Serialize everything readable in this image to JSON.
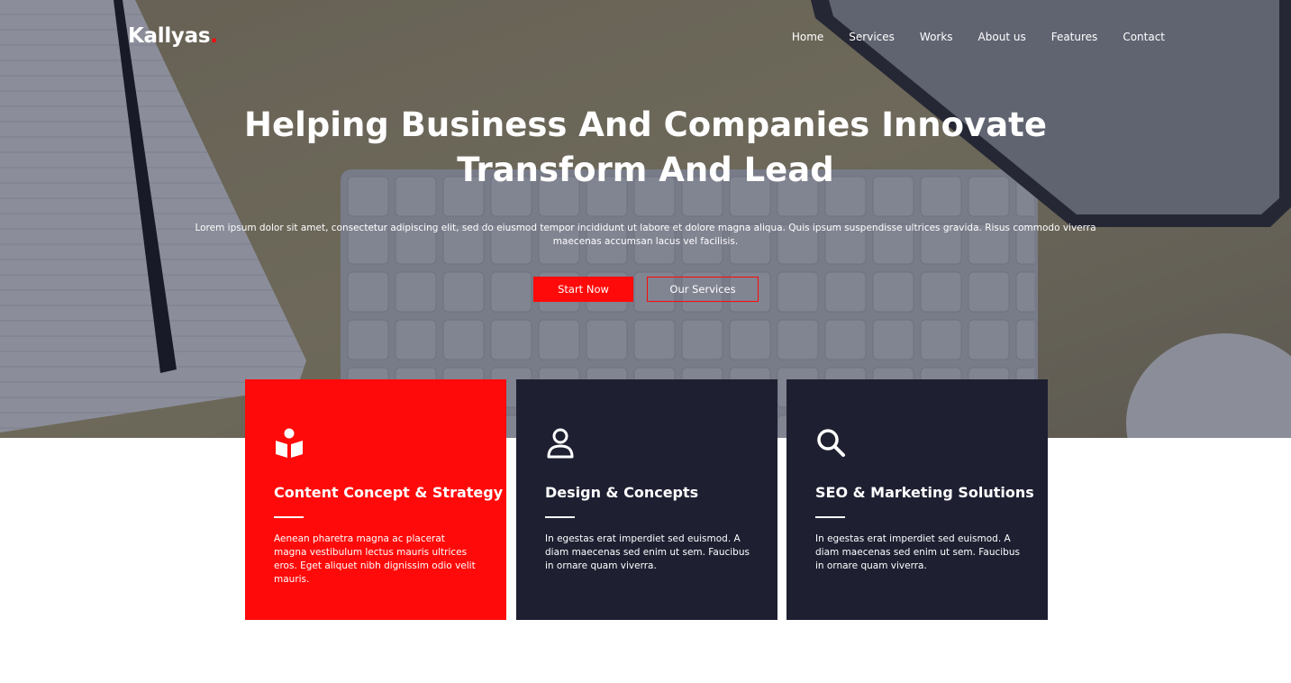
{
  "brand": {
    "name": "Kallyas",
    "dot": ".",
    "accent": "#ff0a0a"
  },
  "nav": {
    "items": [
      "Home",
      "Services",
      "Works",
      "About us",
      "Features",
      "Contact"
    ]
  },
  "hero": {
    "title_line1": "Helping Business And Companies Innovate",
    "title_line2": "Transform And Lead",
    "text": "Lorem ipsum dolor sit amet, consectetur adipiscing elit, sed do eiusmod tempor incididunt ut labore et dolore magna aliqua. Quis ipsum suspendisse ultrices gravida. Risus commodo viverra maecenas accumsan lacus vel facilisis.",
    "primary_button": "Start Now",
    "secondary_button": "Our Services"
  },
  "cards": [
    {
      "icon": "book-reader-icon",
      "title": "Content Concept & Strategy",
      "text": "Aenean pharetra magna ac placerat magna vestibulum lectus mauris ultrices eros. Eget aliquet nibh dignissim odio velit mauris.",
      "color": "#ff0a0a"
    },
    {
      "icon": "user-icon",
      "title": "Design & Concepts",
      "text": "In egestas erat imperdiet sed euismod. A diam maecenas sed enim ut sem. Faucibus in ornare quam viverra.",
      "color": "#1e2032"
    },
    {
      "icon": "search-icon",
      "title": "SEO & Marketing Solutions",
      "text": "In egestas erat imperdiet sed euismod. A diam maecenas sed enim ut sem. Faucibus in ornare quam viverra.",
      "color": "#1e2032"
    }
  ]
}
